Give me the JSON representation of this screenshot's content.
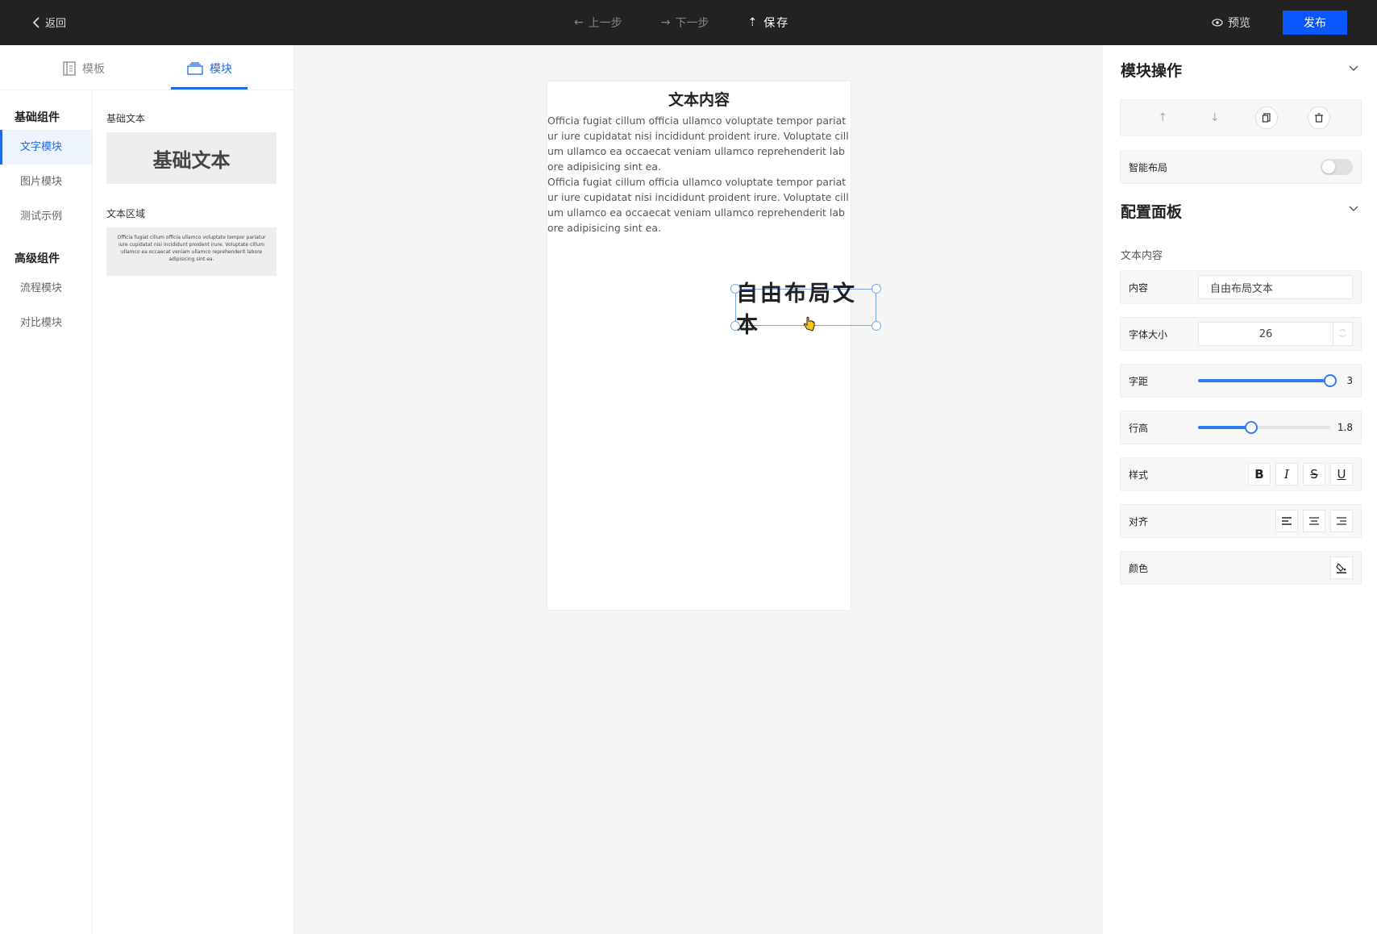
{
  "topbar": {
    "back_label": "返回",
    "undo_label": "上一步",
    "redo_label": "下一步",
    "save_label": "保存",
    "preview_label": "预览",
    "publish_label": "发布"
  },
  "left": {
    "tabs": [
      {
        "label": "模板",
        "icon": "template-icon",
        "active": false
      },
      {
        "label": "模块",
        "icon": "layers-icon",
        "active": true
      }
    ],
    "groups": [
      {
        "title": "基础组件",
        "items": [
          "文字模块",
          "图片模块",
          "测试示例"
        ]
      },
      {
        "title": "高级组件",
        "items": [
          "流程模块",
          "对比模块"
        ]
      }
    ],
    "active_item": "文字模块",
    "blocks": [
      {
        "label": "基础文本",
        "preview": "基础文本"
      },
      {
        "label": "文本区域",
        "preview": "Officia fugiat cillum officia ullamco voluptate tempor pariatur iure cupidatat nisi incididunt proident irure. Voluptate cillum ullamco ea occaecat veniam ullamco reprehenderit labore adipisicing sint ea."
      }
    ]
  },
  "canvas": {
    "title": "文本内容",
    "paragraph1": "Officia fugiat cillum officia ullamco voluptate tempor pariatur iure cupidatat nisi incididunt proident irure. Voluptate cillum ullamco ea occaecat veniam ullamco reprehenderit labore adipisicing sint ea.",
    "paragraph2": "Officia fugiat cillum officia ullamco voluptate tempor pariatur iure cupidatat nisi incididunt proident irure. Voluptate cillum ullamco ea occaecat veniam ullamco reprehenderit labore adipisicing sint ea.",
    "free_text": "自由布局文本"
  },
  "right": {
    "module_ops_title": "模块操作",
    "smart_layout_label": "智能布局",
    "smart_layout_on": false,
    "config_title": "配置面板",
    "subhead": "文本内容",
    "content_label": "内容",
    "content_value": "自由布局文本",
    "font_size_label": "字体大小",
    "font_size_value": "26",
    "letter_spacing_label": "字距",
    "letter_spacing_value": "3",
    "letter_spacing_level": 1.0,
    "line_height_label": "行高",
    "line_height_value": "1.8",
    "line_height_level": 0.4,
    "style_label": "样式",
    "style_buttons": [
      "B",
      "I",
      "S",
      "U"
    ],
    "align_label": "对齐",
    "color_label": "颜色"
  },
  "colors": {
    "accent": "#1f6ae6",
    "publish": "#0a57ff",
    "topbar": "#222222"
  }
}
